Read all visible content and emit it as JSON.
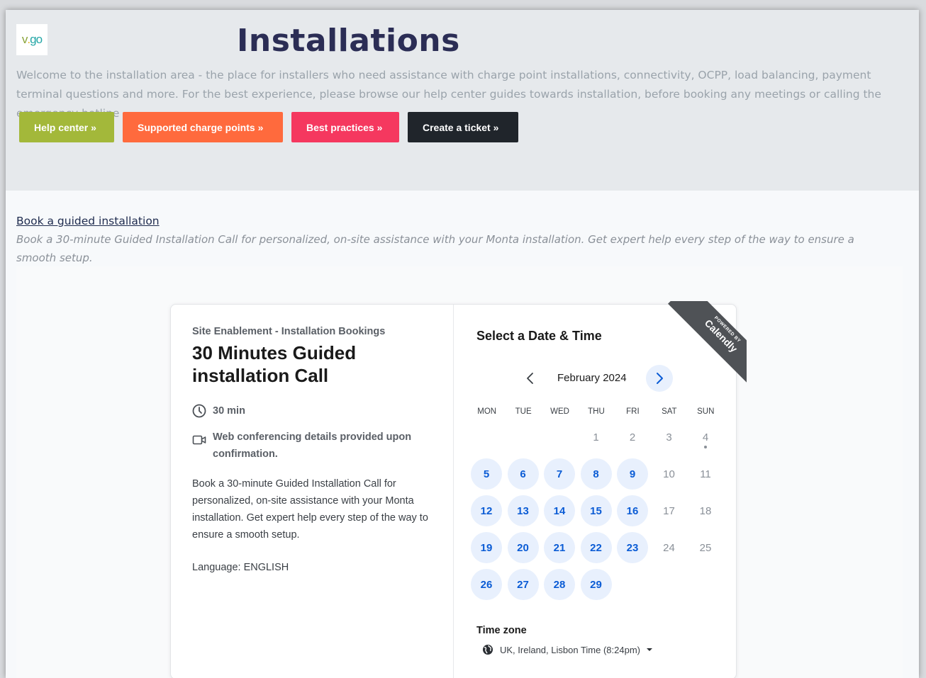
{
  "hero": {
    "logo": {
      "v": "v",
      "dot": ".",
      "go": "go"
    },
    "title": "Installations",
    "intro": "Welcome to the installation area - the place for installers who need assistance with charge point installations, connectivity, OCPP, load balancing, payment terminal questions and more. For the best experience, please browse our help center guides towards installation, before booking any meetings or calling the emergency hotline",
    "buttons": [
      "Help center »",
      "Supported charge points »",
      "Best practices »",
      "Create a ticket »"
    ],
    "colors": {
      "green": "#a3b83a",
      "orange": "#ff6a3d",
      "pink": "#f5385f",
      "dark": "#20252b"
    }
  },
  "booking": {
    "link": "Book a guided installation",
    "description": "Book a 30-minute Guided Installation Call for personalized, on-site assistance with your Monta installation. Get expert help every step of the way to ensure a smooth setup."
  },
  "calendly": {
    "org": "Site Enablement - Installation Bookings",
    "event_name": "30 Minutes Guided installation Call",
    "duration": "30 min",
    "web_conf": "Web conferencing details provided upon confirmation.",
    "description": "Book a 30-minute Guided Installation Call for personalized, on-site assistance with your Monta installation. Get expert help every step of the way to ensure a smooth setup.",
    "language": "Language: ENGLISH",
    "select_title": "Select a Date & Time",
    "month": "February 2024",
    "weekdays": [
      "MON",
      "TUE",
      "WED",
      "THU",
      "FRI",
      "SAT",
      "SUN"
    ],
    "weeks": [
      [
        null,
        null,
        null,
        "1",
        "2",
        "3",
        "4"
      ],
      [
        "5",
        "6",
        "7",
        "8",
        "9",
        "10",
        "11"
      ],
      [
        "12",
        "13",
        "14",
        "15",
        "16",
        "17",
        "18"
      ],
      [
        "19",
        "20",
        "21",
        "22",
        "23",
        "24",
        "25"
      ],
      [
        "26",
        "27",
        "28",
        "29",
        null,
        null,
        null
      ]
    ],
    "available": [
      "5",
      "6",
      "7",
      "8",
      "9",
      "12",
      "13",
      "14",
      "15",
      "16",
      "19",
      "20",
      "21",
      "22",
      "23",
      "26",
      "27",
      "28",
      "29"
    ],
    "today": "4",
    "timezone_label": "Time zone",
    "timezone": "UK, Ireland, Lisbon Time (8:24pm)",
    "ribbon_small": "POWERED BY",
    "ribbon_big": "Calendly",
    "accent_color": "#0b5cd5"
  }
}
